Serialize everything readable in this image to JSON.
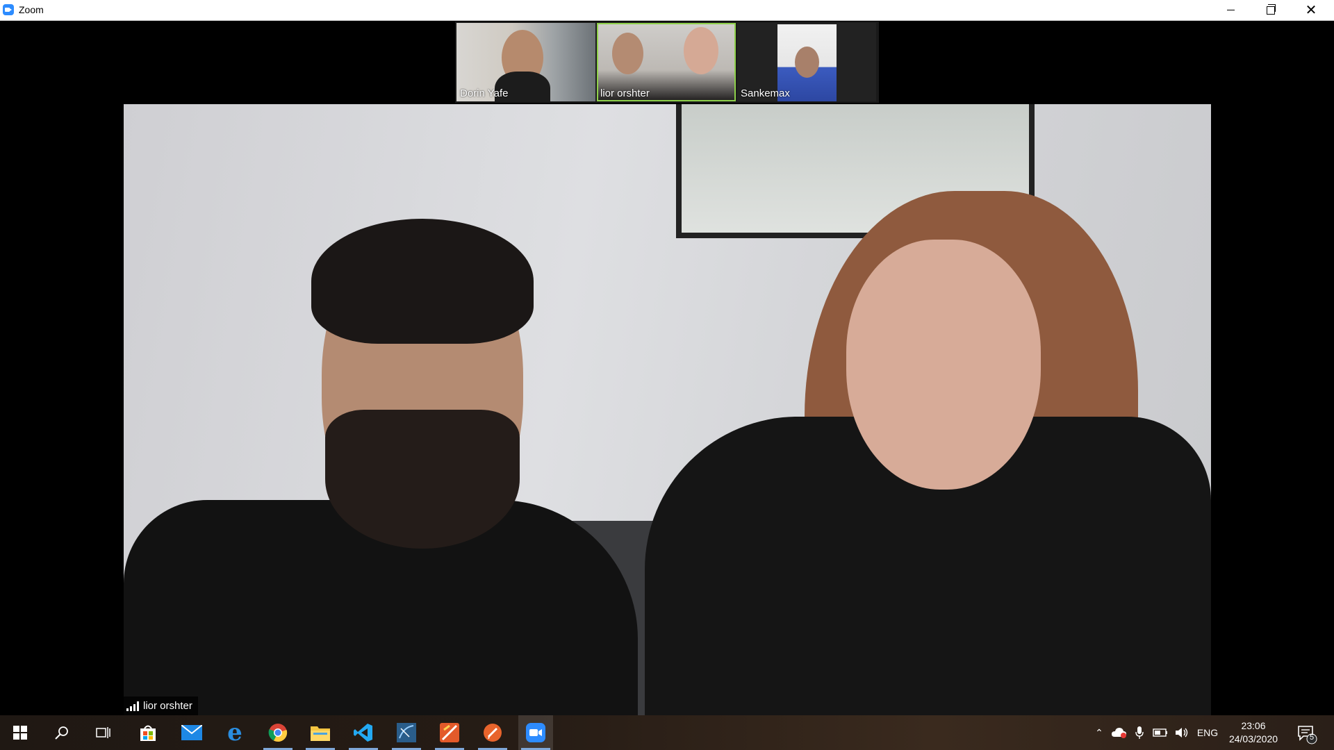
{
  "window": {
    "title": "Zoom"
  },
  "thumbnails": [
    {
      "name": "Dorin Yafe"
    },
    {
      "name": "lior orshter",
      "active_speaker": true
    },
    {
      "name": "Sankemax"
    }
  ],
  "main_video": {
    "speaker_name": "lior orshter"
  },
  "taskbar": {
    "language": "ENG",
    "time": "23:06",
    "date": "24/03/2020",
    "notification_count": "5",
    "apps": [
      "start-icon",
      "search-icon",
      "task-view-icon",
      "store-icon",
      "mail-icon",
      "edge-icon",
      "chrome-icon",
      "file-explorer-icon",
      "vscode-icon",
      "app-icon",
      "app-icon-2",
      "app-icon-3",
      "zoom-icon"
    ]
  },
  "colors": {
    "zoom_blue": "#2d8cff",
    "active_outline": "#8ed04a",
    "taskbar_accent": "#7fa7d8"
  }
}
